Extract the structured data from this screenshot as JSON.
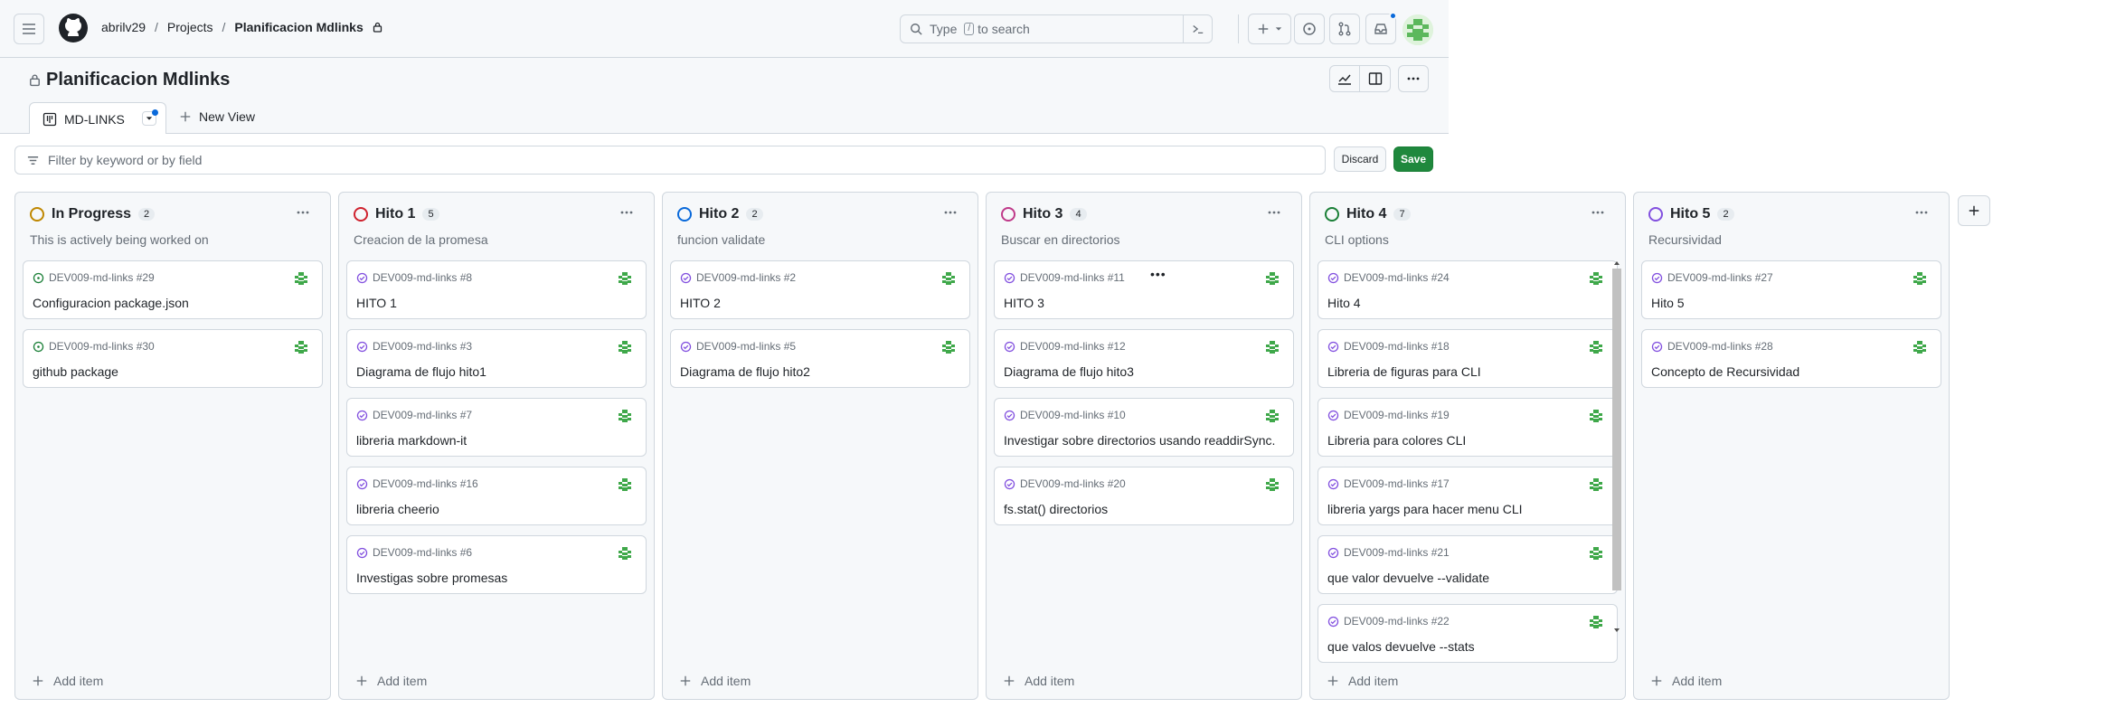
{
  "header": {
    "breadcrumbs": [
      "abrilv29",
      "Projects",
      "Planificacion Mdlinks"
    ],
    "search_prefix": "Type",
    "search_key": "/",
    "search_suffix": "to search"
  },
  "project": {
    "title": "Planificacion Mdlinks",
    "view_tab": "MD-LINKS",
    "new_view": "New View"
  },
  "filter": {
    "placeholder": "Filter by keyword or by field",
    "discard": "Discard",
    "save": "Save"
  },
  "colors": {
    "open": "#1a7f37",
    "closed": "#8250df",
    "accent": "#0969da",
    "save": "#1f883d"
  },
  "add_item_label": "Add item",
  "columns": [
    {
      "name": "In Progress",
      "count": "2",
      "color": "#bf8700",
      "description": "This is actively being worked on",
      "cards": [
        {
          "ref": "DEV009-md-links #29",
          "title": "Configuracion package.json",
          "state": "open"
        },
        {
          "ref": "DEV009-md-links #30",
          "title": "github package",
          "state": "open"
        }
      ]
    },
    {
      "name": "Hito 1",
      "count": "5",
      "color": "#cf222e",
      "description": "Creacion de la promesa",
      "cards": [
        {
          "ref": "DEV009-md-links #8",
          "title": "HITO 1",
          "state": "closed"
        },
        {
          "ref": "DEV009-md-links #3",
          "title": "Diagrama de flujo hito1",
          "state": "closed"
        },
        {
          "ref": "DEV009-md-links #7",
          "title": "libreria markdown-it",
          "state": "closed"
        },
        {
          "ref": "DEV009-md-links #16",
          "title": "libreria cheerio",
          "state": "closed"
        },
        {
          "ref": "DEV009-md-links #6",
          "title": "Investigas sobre promesas",
          "state": "closed"
        }
      ]
    },
    {
      "name": "Hito 2",
      "count": "2",
      "color": "#0969da",
      "description": "funcion validate",
      "cards": [
        {
          "ref": "DEV009-md-links #2",
          "title": "HITO 2",
          "state": "closed"
        },
        {
          "ref": "DEV009-md-links #5",
          "title": "Diagrama de flujo hito2",
          "state": "closed"
        }
      ]
    },
    {
      "name": "Hito 3",
      "count": "4",
      "color": "#bf3989",
      "description": "Buscar en directorios",
      "cards": [
        {
          "ref": "DEV009-md-links #11",
          "title": "HITO 3",
          "state": "closed",
          "menu": "•••"
        },
        {
          "ref": "DEV009-md-links #12",
          "title": "Diagrama de flujo hito3",
          "state": "closed"
        },
        {
          "ref": "DEV009-md-links #10",
          "title": "Investigar sobre directorios usando readdirSync.",
          "state": "closed"
        },
        {
          "ref": "DEV009-md-links #20",
          "title": "fs.stat() directorios",
          "state": "closed"
        }
      ]
    },
    {
      "name": "Hito 4",
      "count": "7",
      "color": "#1a7f37",
      "description": "CLI options",
      "cards": [
        {
          "ref": "DEV009-md-links #24",
          "title": "Hito 4",
          "state": "closed"
        },
        {
          "ref": "DEV009-md-links #18",
          "title": "Libreria de figuras para CLI",
          "state": "closed"
        },
        {
          "ref": "DEV009-md-links #19",
          "title": "Libreria para colores CLI",
          "state": "closed"
        },
        {
          "ref": "DEV009-md-links #17",
          "title": "libreria yargs para hacer menu CLI",
          "state": "closed"
        },
        {
          "ref": "DEV009-md-links #21",
          "title": "que valor devuelve --validate",
          "state": "closed"
        },
        {
          "ref": "DEV009-md-links #22",
          "title": "que valos devuelve --stats",
          "state": "closed"
        }
      ]
    },
    {
      "name": "Hito 5",
      "count": "2",
      "color": "#8250df",
      "description": "Recursividad",
      "cards": [
        {
          "ref": "DEV009-md-links #27",
          "title": "Hito 5",
          "state": "closed"
        },
        {
          "ref": "DEV009-md-links #28",
          "title": "Concepto de Recursividad",
          "state": "closed"
        }
      ]
    }
  ]
}
